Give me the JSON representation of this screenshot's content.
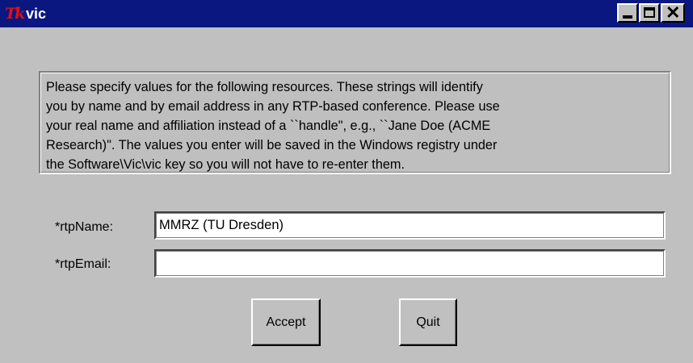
{
  "window": {
    "title": "vic",
    "title_icon": "tk-feather-logo",
    "controls": {
      "minimize": "minimize-icon",
      "maximize": "maximize-icon",
      "close_glyph": "✕"
    }
  },
  "message": {
    "lines": [
      "Please specify values for the following resources.  These strings will identify",
      "you by name and by email address  in any RTP-based conference.  Please use",
      "your real name and  affiliation instead of a ``handle\", e.g., ``Jane Doe (ACME",
      "Research)\".  The values you enter will be saved in the Windows registry under",
      "the  Software\\Vic\\vic key so you will not have to re-enter them."
    ]
  },
  "form": {
    "rtp_name_label": "*rtpName:",
    "rtp_name_value": "MMRZ (TU Dresden)",
    "rtp_email_label": "*rtpEmail:",
    "rtp_email_value": ""
  },
  "buttons": {
    "accept": "Accept",
    "quit": "Quit"
  },
  "colors": {
    "titlebar": "#0b1781",
    "face": "#c0c0c0",
    "logo": "#e01010"
  }
}
